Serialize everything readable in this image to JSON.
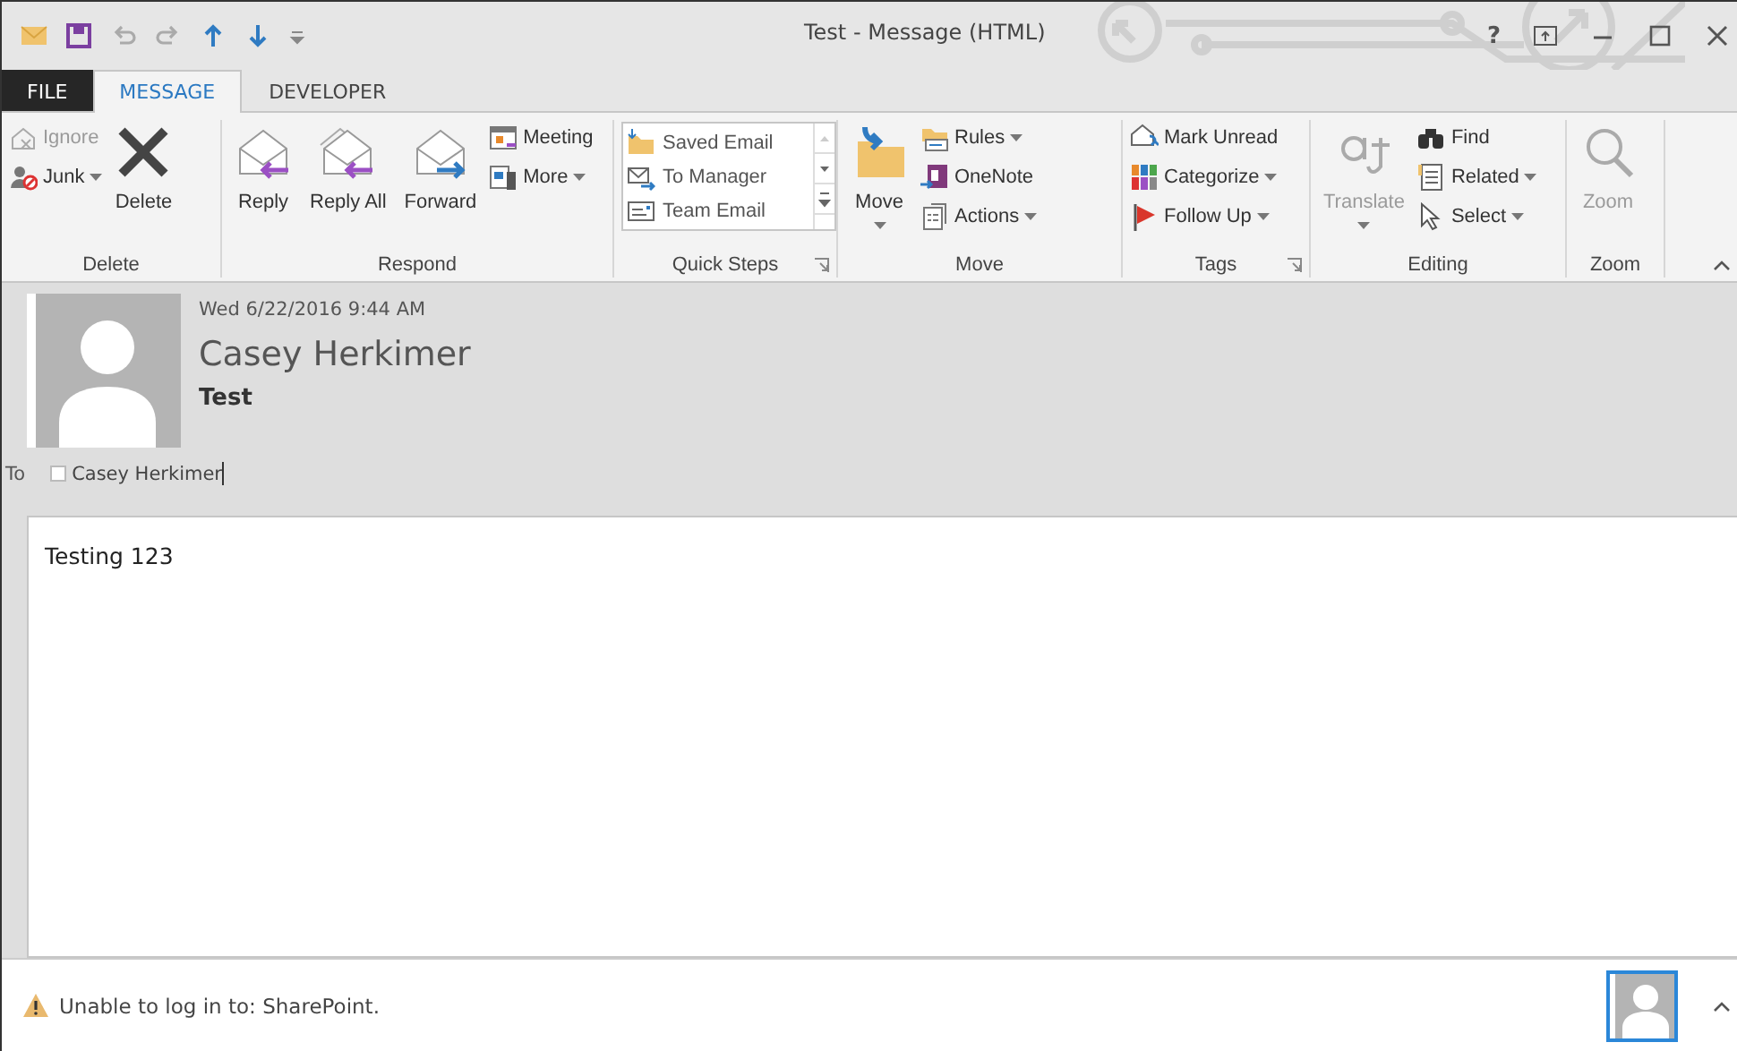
{
  "window": {
    "title": "Test - Message (HTML)",
    "help": "?"
  },
  "tabs": [
    {
      "label": "FILE",
      "kind": "file",
      "selected": false
    },
    {
      "label": "MESSAGE",
      "kind": "tab",
      "selected": true
    },
    {
      "label": "DEVELOPER",
      "kind": "tab",
      "selected": false
    }
  ],
  "ribbon": {
    "groups": [
      {
        "label": "Delete",
        "launcher": false,
        "columns": [
          {
            "kind": "stack",
            "items": [
              {
                "label": "Ignore",
                "dropdown": false,
                "disabled": true
              },
              {
                "label": "Junk",
                "dropdown": true,
                "disabled": false
              }
            ]
          },
          {
            "kind": "large",
            "items": [
              {
                "label": "Delete",
                "dropdown": false,
                "disabled": false
              }
            ]
          }
        ]
      },
      {
        "label": "Respond",
        "launcher": false,
        "columns": [
          {
            "kind": "large",
            "items": [
              {
                "label": "Reply",
                "dropdown": false,
                "disabled": false
              }
            ]
          },
          {
            "kind": "large",
            "items": [
              {
                "label": "Reply All",
                "dropdown": false,
                "disabled": false
              }
            ]
          },
          {
            "kind": "large",
            "items": [
              {
                "label": "Forward",
                "dropdown": false,
                "disabled": false
              }
            ]
          },
          {
            "kind": "stack",
            "items": [
              {
                "label": "Meeting",
                "dropdown": false,
                "disabled": false
              },
              {
                "label": "More",
                "dropdown": true,
                "disabled": false
              }
            ]
          }
        ]
      },
      {
        "label": "Quick Steps",
        "launcher": true,
        "columns": [
          {
            "kind": "gallery",
            "items": [
              {
                "label": "Saved Email"
              },
              {
                "label": "To Manager"
              },
              {
                "label": "Team Email"
              }
            ]
          }
        ]
      },
      {
        "label": "Move",
        "launcher": false,
        "columns": [
          {
            "kind": "large",
            "items": [
              {
                "label": "Move",
                "dropdown": true,
                "disabled": false
              }
            ]
          },
          {
            "kind": "stack",
            "items": [
              {
                "label": "Rules",
                "dropdown": true,
                "disabled": false
              },
              {
                "label": "OneNote",
                "dropdown": false,
                "disabled": false
              },
              {
                "label": "Actions",
                "dropdown": true,
                "disabled": false
              }
            ]
          }
        ]
      },
      {
        "label": "Tags",
        "launcher": true,
        "columns": [
          {
            "kind": "stack",
            "items": [
              {
                "label": "Mark Unread",
                "dropdown": false,
                "disabled": false
              },
              {
                "label": "Categorize",
                "dropdown": true,
                "disabled": false
              },
              {
                "label": "Follow Up",
                "dropdown": true,
                "disabled": false
              }
            ]
          }
        ]
      },
      {
        "label": "Editing",
        "launcher": false,
        "columns": [
          {
            "kind": "large",
            "items": [
              {
                "label": "Translate",
                "dropdown": true,
                "disabled": true
              }
            ]
          },
          {
            "kind": "stack",
            "items": [
              {
                "label": "Find",
                "dropdown": false,
                "disabled": false
              },
              {
                "label": "Related",
                "dropdown": true,
                "disabled": false
              },
              {
                "label": "Select",
                "dropdown": true,
                "disabled": false
              }
            ]
          }
        ]
      },
      {
        "label": "Zoom",
        "launcher": false,
        "columns": [
          {
            "kind": "large",
            "items": [
              {
                "label": "Zoom",
                "dropdown": false,
                "disabled": true
              }
            ]
          }
        ]
      }
    ]
  },
  "message": {
    "date": "Wed 6/22/2016 9:44 AM",
    "sender": "Casey Herkimer",
    "subject": "Test",
    "to_label": "To",
    "recipients": [
      "Casey Herkimer"
    ],
    "body": "Testing 123"
  },
  "status_bar": {
    "message": "Unable to log in to: SharePoint."
  }
}
